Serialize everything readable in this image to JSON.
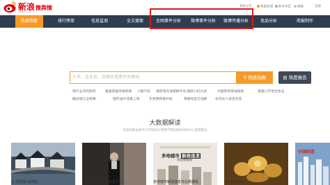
{
  "header": {
    "logo_text": "新浪",
    "logo_sub_text": "微舆情",
    "logo_url": "yq.sina.com",
    "top_links": [
      {
        "label": "系统公告",
        "icon": "announcement-icon"
      },
      {
        "label": "客服热线",
        "icon": "phone-icon"
      },
      {
        "label": "新手专区",
        "icon": "newbie-icon"
      },
      {
        "label": "客服",
        "icon": "chat-icon"
      },
      {
        "label": "注册",
        "icon": ""
      }
    ]
  },
  "nav": {
    "items": [
      {
        "label": "热度指数",
        "active": true
      },
      {
        "label": "排行榜单",
        "active": false
      },
      {
        "label": "信息监测",
        "active": false
      },
      {
        "label": "全文搜索",
        "active": false
      },
      {
        "label": "全网事件分析",
        "active": false
      },
      {
        "label": "微博事件分析",
        "active": false
      },
      {
        "label": "微博传播分析",
        "active": false
      },
      {
        "label": "竞品分析",
        "active": false
      },
      {
        "label": "简报制作",
        "active": false
      }
    ]
  },
  "search": {
    "placeholder": "人名、企业名、品牌名或事件关键词",
    "button_label": "热度指数",
    "report_button_label": "热度报告"
  },
  "hot_words": {
    "row1": [
      "银行业风险防控",
      "美国前国务卿病重",
      "小鹏汽车",
      "美航母北进朝鲜半岛",
      "围棋人机大战",
      "中国职场幸福指数",
      "美国小学发生枪击"
    ],
    "row2": [
      "酷设城认证结果",
      "国内油价或再上调",
      "东莞限购再升级",
      "铁路局官方道歉",
      "状况达人紧急状态"
    ]
  },
  "section": {
    "title": "大数据解读",
    "subtitle": "热度指数由清华大学新闻与传播学院新媒体研究中心提供算法"
  },
  "cards": [
    {
      "caption": "从‘慢直播’看网友…",
      "image": "water-town-photo"
    },
    {
      "caption": "从热度看网友：“四名男人…",
      "image": "man-standing-photo"
    },
    {
      "caption": "多地楼市新政连发背后数据看…",
      "image": "property-market-photo",
      "overlay_title": "多地楼市",
      "overlay_badge": "新政连发",
      "overlay_sub": "背后数据看"
    },
    {
      "caption": "“牛市还在吗”",
      "image": "coins-photo"
    },
    {
      "caption": "中国制造",
      "image": "china-manufacturing-photo"
    }
  ],
  "colors": {
    "brand_red": "#e60012",
    "accent_orange": "#f49b2a",
    "nav_bg": "#2e3d4f",
    "highlight_red": "#e01818"
  }
}
